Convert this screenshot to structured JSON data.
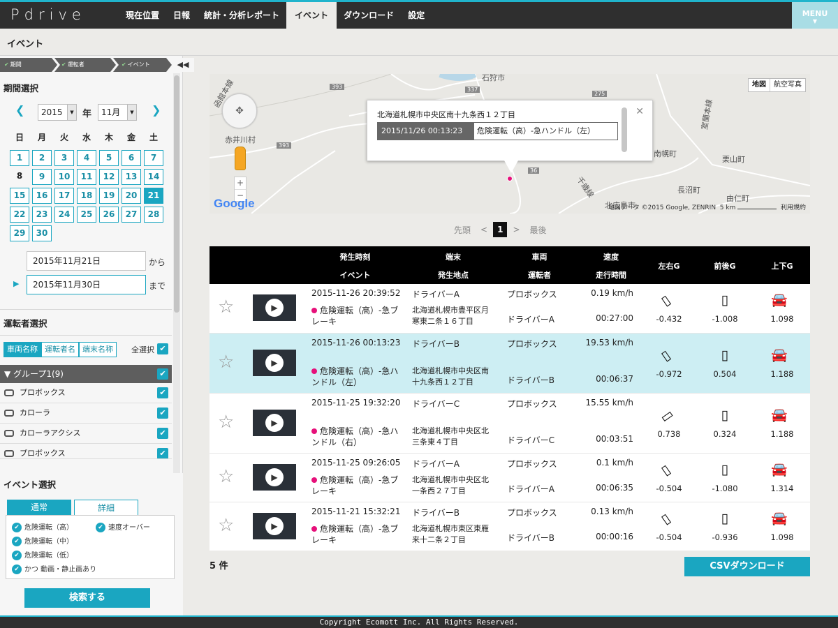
{
  "app": {
    "logo": "Pdrive"
  },
  "nav": {
    "items": [
      "現在位置",
      "日報",
      "統計・分析レポート",
      "イベント",
      "ダウンロード",
      "設定"
    ],
    "active": "イベント",
    "menu_label": "MENU"
  },
  "page": {
    "title": "イベント"
  },
  "steps": {
    "items": [
      "期間",
      "運転者",
      "イベント"
    ],
    "collapse": "◀◀"
  },
  "period": {
    "section_title": "期間選択",
    "year": "2015",
    "year_suffix": "年",
    "month": "11月",
    "weekdays": [
      "日",
      "月",
      "火",
      "水",
      "木",
      "金",
      "土"
    ],
    "selected_day": "21",
    "start": "2015年11月21日",
    "start_suffix": "から",
    "end": "2015年11月30日",
    "end_suffix": "まで"
  },
  "driver": {
    "section_title": "運転者選択",
    "tabs": [
      "車両名称",
      "運転者名",
      "端末名称"
    ],
    "select_all": "全選択",
    "group": "▼ グループ1(9)",
    "vehicles": [
      "プロボックス",
      "カローラ",
      "カローラアクシス",
      "プロボックス"
    ]
  },
  "event_select": {
    "section_title": "イベント選択",
    "tabs": [
      "通常",
      "詳細"
    ],
    "items": [
      "危険運転（高）",
      "速度オーバー",
      "危険運転（中）",
      "危険運転（低）",
      "かつ 動画・静止画あり"
    ],
    "search_button": "検索する"
  },
  "map": {
    "type_buttons": [
      "地図",
      "航空写真"
    ],
    "labels": [
      "石狩市",
      "赤井川村",
      "南幌町",
      "栗山町",
      "長沼町",
      "由仁町",
      "北広島市",
      "千歳線",
      "室蘭本線",
      "函館本線"
    ],
    "road_numbers": [
      "393",
      "337",
      "275",
      "393",
      "36"
    ],
    "copyright": "地図データ ©2015 Google, ZENRIN",
    "scale": "5 km",
    "terms": "利用規約",
    "google_logo": "Google",
    "info": {
      "address": "北海道札幌市中央区南十九条西１２丁目",
      "datetime": "2015/11/26 00:13:23",
      "event": "危険運転（高）-急ハンドル（左）"
    }
  },
  "pager": {
    "first": "先頭",
    "prev": "<",
    "current": "1",
    "next": ">",
    "last": "最後"
  },
  "table": {
    "headers": {
      "time": "発生時刻",
      "event": "イベント",
      "terminal": "端末",
      "location": "発生地点",
      "vehicle": "車両",
      "driver": "運転者",
      "speed": "速度",
      "duration": "走行時間",
      "lateral": "左右G",
      "longitudinal": "前後G",
      "vertical": "上下G"
    },
    "rows": [
      {
        "time": "2015-11-26 20:39:52",
        "event": "危険運転（高）-急ブレーキ",
        "terminal": "ドライバーA",
        "location": "北海道札幌市豊平区月寒東二条１６丁目",
        "vehicle": "プロボックス",
        "driver": "ドライバーA",
        "speed": "0.19 km/h",
        "duration": "00:27:00",
        "lat_g": "-0.432",
        "lon_g": "-1.008",
        "vert_g": "1.098"
      },
      {
        "time": "2015-11-26 00:13:23",
        "event": "危険運転（高）-急ハンドル（左）",
        "terminal": "ドライバーB",
        "location": "北海道札幌市中央区南十九条西１２丁目",
        "vehicle": "プロボックス",
        "driver": "ドライバーB",
        "speed": "19.53 km/h",
        "duration": "00:06:37",
        "lat_g": "-0.972",
        "lon_g": "0.504",
        "vert_g": "1.188"
      },
      {
        "time": "2015-11-25 19:32:20",
        "event": "危険運転（高）-急ハンドル（右）",
        "terminal": "ドライバーC",
        "location": "北海道札幌市中央区北三条東４丁目",
        "vehicle": "プロボックス",
        "driver": "ドライバーC",
        "speed": "15.55 km/h",
        "duration": "00:03:51",
        "lat_g": "0.738",
        "lon_g": "0.324",
        "vert_g": "1.188"
      },
      {
        "time": "2015-11-25 09:26:05",
        "event": "危険運転（高）-急ブレーキ",
        "terminal": "ドライバーA",
        "location": "北海道札幌市中央区北一条西２７丁目",
        "vehicle": "プロボックス",
        "driver": "ドライバーA",
        "speed": "0.1 km/h",
        "duration": "00:06:35",
        "lat_g": "-0.504",
        "lon_g": "-1.080",
        "vert_g": "1.314"
      },
      {
        "time": "2015-11-21 15:32:21",
        "event": "危険運転（高）-急ブレーキ",
        "terminal": "ドライバーB",
        "location": "北海道札幌市東区東雁来十二条２丁目",
        "vehicle": "プロボックス",
        "driver": "ドライバーB",
        "speed": "0.13 km/h",
        "duration": "00:00:16",
        "lat_g": "-0.504",
        "lon_g": "-0.936",
        "vert_g": "1.098"
      }
    ]
  },
  "result_count": "5 件",
  "csv_button": "CSVダウンロード",
  "footer": "Copyright Ecomott Inc. All Rights Reserved.",
  "colors": {
    "accent": "#1aa6c1",
    "header": "#2f2f2f",
    "highlight_row": "#cdeef3",
    "event_dot": "#e6107a"
  }
}
